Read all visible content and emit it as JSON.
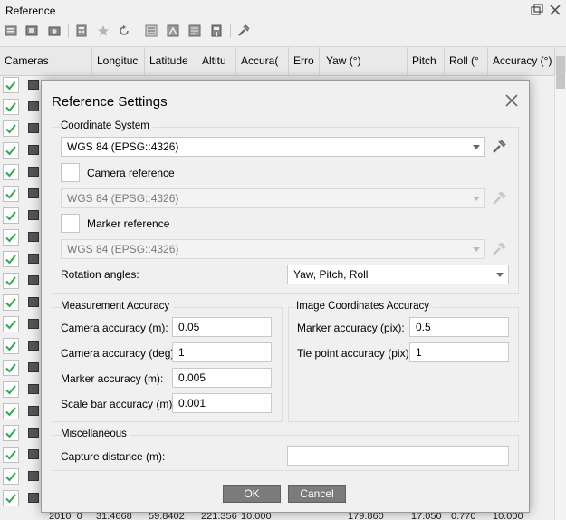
{
  "panel": {
    "title": "Reference",
    "toolbar_icons": [
      "import-icon",
      "export-icon",
      "camera-export-icon",
      "calculator-icon",
      "star-icon",
      "refresh-icon",
      "view-source-icon",
      "view-estimated-icon",
      "view-errors-icon",
      "view-variance-icon",
      "settings-icon"
    ],
    "window_icons": [
      "restore-window-icon",
      "close-icon"
    ]
  },
  "table": {
    "columns": [
      "Cameras",
      "Longituc",
      "Latitude",
      "Altitu",
      "Accura(",
      "Erro",
      "Yaw (°)",
      "Pitch",
      "Roll (°",
      "Accuracy (°)"
    ],
    "visible_row_count": 20,
    "partial_row": [
      "2010_0",
      "31.4668",
      "59.8402",
      "221.356",
      "10.000",
      "179.860",
      "17.050",
      "0.770",
      "10.000"
    ]
  },
  "dialog": {
    "title": "Reference Settings",
    "coordinate_system": {
      "group_title": "Coordinate System",
      "crs_value": "WGS 84 (EPSG::4326)",
      "camera_reference_label": "Camera reference",
      "camera_crs_value": "WGS 84 (EPSG::4326)",
      "marker_reference_label": "Marker reference",
      "marker_crs_value": "WGS 84 (EPSG::4326)",
      "rotation_angles_label": "Rotation angles:",
      "rotation_angles_value": "Yaw, Pitch, Roll"
    },
    "measurement_accuracy": {
      "group_title": "Measurement Accuracy",
      "camera_accuracy_m_label": "Camera accuracy (m):",
      "camera_accuracy_m_value": "0.05",
      "camera_accuracy_deg_label": "Camera accuracy (deg):",
      "camera_accuracy_deg_value": "1",
      "marker_accuracy_m_label": "Marker accuracy (m):",
      "marker_accuracy_m_value": "0.005",
      "scale_bar_accuracy_label": "Scale bar accuracy (m):",
      "scale_bar_accuracy_value": "0.001"
    },
    "image_coordinates_accuracy": {
      "group_title": "Image Coordinates Accuracy",
      "marker_accuracy_pix_label": "Marker accuracy (pix):",
      "marker_accuracy_pix_value": "0.5",
      "tie_point_accuracy_label": "Tie point accuracy (pix):",
      "tie_point_accuracy_value": "1"
    },
    "miscellaneous": {
      "group_title": "Miscellaneous",
      "capture_distance_label": "Capture distance (m):",
      "capture_distance_value": ""
    },
    "ok_label": "OK",
    "cancel_label": "Cancel"
  }
}
